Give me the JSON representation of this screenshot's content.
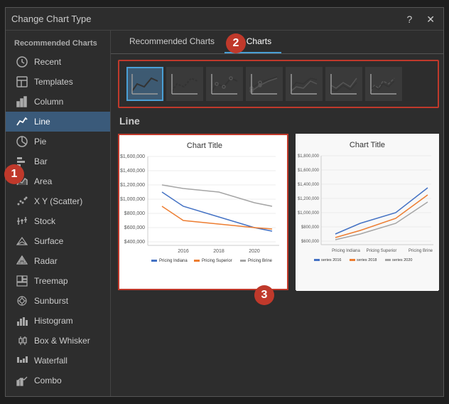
{
  "dialog": {
    "title": "Change Chart Type",
    "close_btn": "✕",
    "help_btn": "?"
  },
  "sidebar": {
    "section_header": "Recommended Charts",
    "items": [
      {
        "id": "recent",
        "label": "Recent",
        "icon": "recent"
      },
      {
        "id": "templates",
        "label": "Templates",
        "icon": "templates"
      },
      {
        "id": "column",
        "label": "Column",
        "icon": "column"
      },
      {
        "id": "line",
        "label": "Line",
        "icon": "line",
        "active": true
      },
      {
        "id": "pie",
        "label": "Pie",
        "icon": "pie"
      },
      {
        "id": "bar",
        "label": "Bar",
        "icon": "bar"
      },
      {
        "id": "area",
        "label": "Area",
        "icon": "area"
      },
      {
        "id": "xy",
        "label": "X Y (Scatter)",
        "icon": "scatter"
      },
      {
        "id": "stock",
        "label": "Stock",
        "icon": "stock"
      },
      {
        "id": "surface",
        "label": "Surface",
        "icon": "surface"
      },
      {
        "id": "radar",
        "label": "Radar",
        "icon": "radar"
      },
      {
        "id": "treemap",
        "label": "Treemap",
        "icon": "treemap"
      },
      {
        "id": "sunburst",
        "label": "Sunburst",
        "icon": "sunburst"
      },
      {
        "id": "histogram",
        "label": "Histogram",
        "icon": "histogram"
      },
      {
        "id": "box",
        "label": "Box & Whisker",
        "icon": "box"
      },
      {
        "id": "waterfall",
        "label": "Waterfall",
        "icon": "waterfall"
      },
      {
        "id": "combo",
        "label": "Combo",
        "icon": "combo"
      }
    ]
  },
  "tabs": [
    {
      "id": "recommended",
      "label": "Recommended Charts",
      "active": false
    },
    {
      "id": "all",
      "label": "All Charts",
      "active": true
    }
  ],
  "section": {
    "title": "Line"
  },
  "chart_title": "Chart Title",
  "callouts": {
    "c1": "1",
    "c2": "2",
    "c3": "3"
  }
}
